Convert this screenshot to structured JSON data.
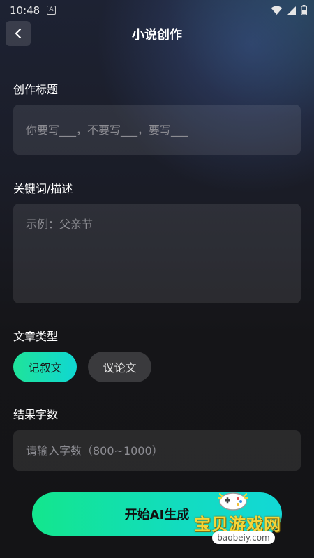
{
  "status_bar": {
    "time": "10:48",
    "notification_letter": "A"
  },
  "header": {
    "title": "小说创作"
  },
  "title_section": {
    "label": "创作标题",
    "placeholder": "你要写___，不要写___，要写___"
  },
  "desc_section": {
    "label": "关键词/描述",
    "placeholder": "示例：父亲节"
  },
  "type_section": {
    "label": "文章类型",
    "options": [
      {
        "label": "记叙文",
        "selected": true
      },
      {
        "label": "议论文",
        "selected": false
      }
    ]
  },
  "count_section": {
    "label": "结果字数",
    "placeholder": "请输入字数（800~1000）"
  },
  "action": {
    "start_label": "开始AI生成"
  },
  "watermark": {
    "text": "宝贝游戏网",
    "url": "baobeiy.com"
  },
  "colors": {
    "accent_start": "#13e68d",
    "accent_end": "#12d8d6",
    "field_bg": "#2a2b31",
    "background": "#151518"
  }
}
